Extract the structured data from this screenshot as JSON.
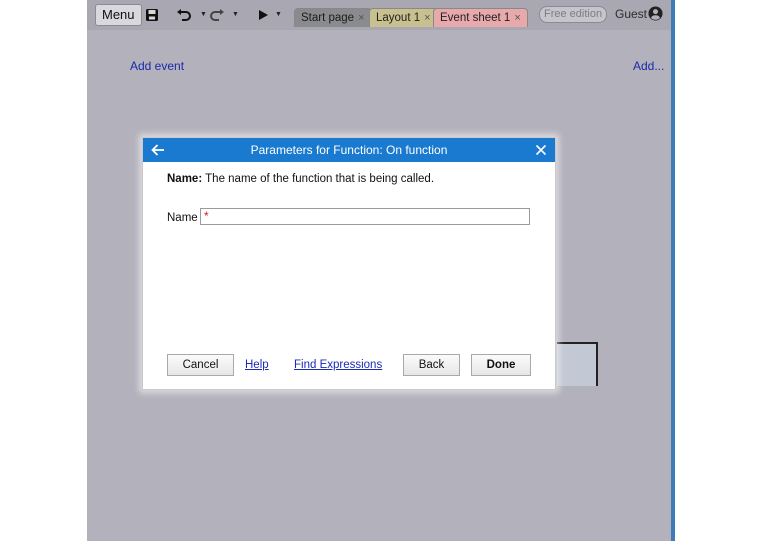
{
  "toolbar": {
    "menu_label": "Menu",
    "save_icon": "floppy-disk-icon",
    "undo_icon": "undo-icon",
    "redo_icon": "redo-icon",
    "play_icon": "play-icon",
    "tabs": [
      {
        "label": "Start page",
        "close": "×"
      },
      {
        "label": "Layout 1",
        "close": "×"
      },
      {
        "label": "Event sheet 1",
        "close": "×"
      }
    ],
    "free_edition": "Free edition",
    "user_label": "Guest"
  },
  "event_sheet": {
    "add_event": "Add event",
    "add_more": "Add..."
  },
  "dialog": {
    "title": "Parameters for Function: On function",
    "description_bold": "Name:",
    "description_text": " The name of the function that is being called.",
    "field_label": "Name",
    "field_value": "",
    "required_marker": "*",
    "buttons": {
      "cancel": "Cancel",
      "help": "Help",
      "find_expressions": "Find Expressions",
      "back": "Back",
      "done": "Done"
    }
  },
  "colors": {
    "title_bar": "#1a7ad0",
    "backdrop": "#b3b1bb",
    "link": "#1c2bb5"
  }
}
